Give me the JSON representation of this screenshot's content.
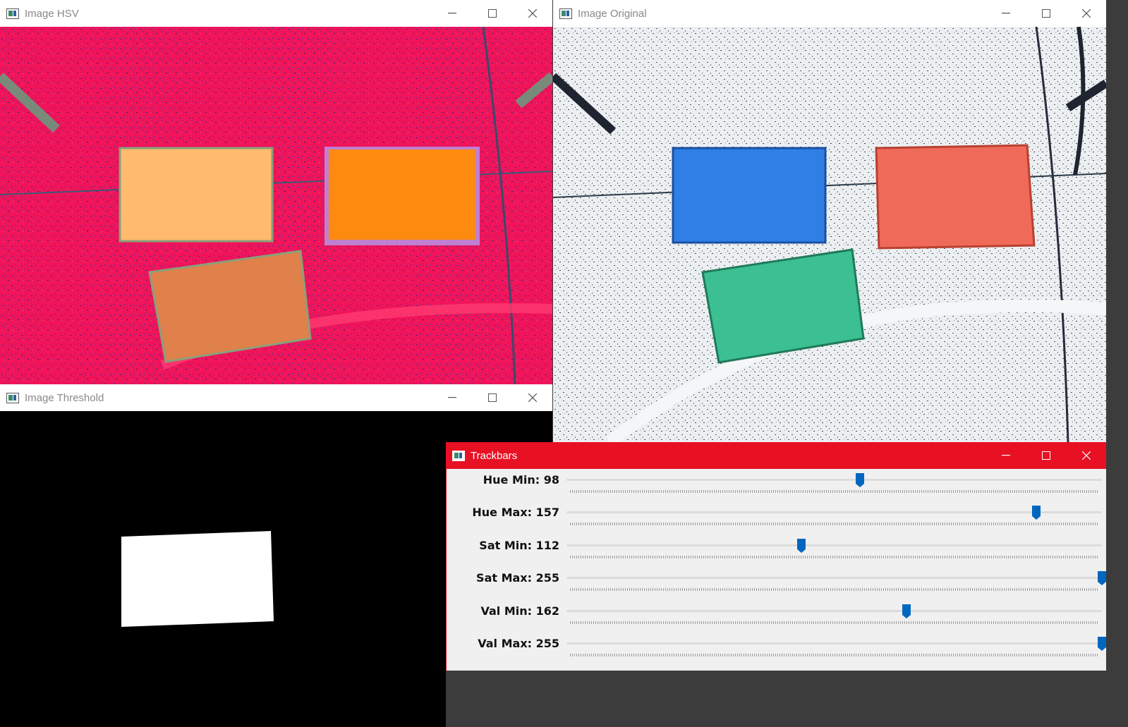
{
  "windows": {
    "hsv": {
      "title": "Image HSV"
    },
    "original": {
      "title": "Image Original"
    },
    "threshold": {
      "title": "Image Threshold"
    },
    "trackbars": {
      "title": "Trackbars"
    }
  },
  "trackbars": [
    {
      "label": "Hue Min: 98",
      "value": 98,
      "max": 179
    },
    {
      "label": "Hue Max: 157",
      "value": 157,
      "max": 179
    },
    {
      "label": "Sat Min: 112",
      "value": 112,
      "max": 255
    },
    {
      "label": "Sat Max: 255",
      "value": 255,
      "max": 255
    },
    {
      "label": "Val Min: 162",
      "value": 162,
      "max": 255
    },
    {
      "label": "Val Max: 255",
      "value": 255,
      "max": 255
    }
  ],
  "colors": {
    "active_titlebar": "#e81123",
    "slider_accent": "#0067c0",
    "hsv_background": "#f0145a",
    "box_blue": "#2f7fe6",
    "box_red": "#f06a5a",
    "box_green": "#3bbf93"
  },
  "icons": [
    "app-icon",
    "minimize-icon",
    "maximize-icon",
    "close-icon",
    "slider-thumb"
  ]
}
